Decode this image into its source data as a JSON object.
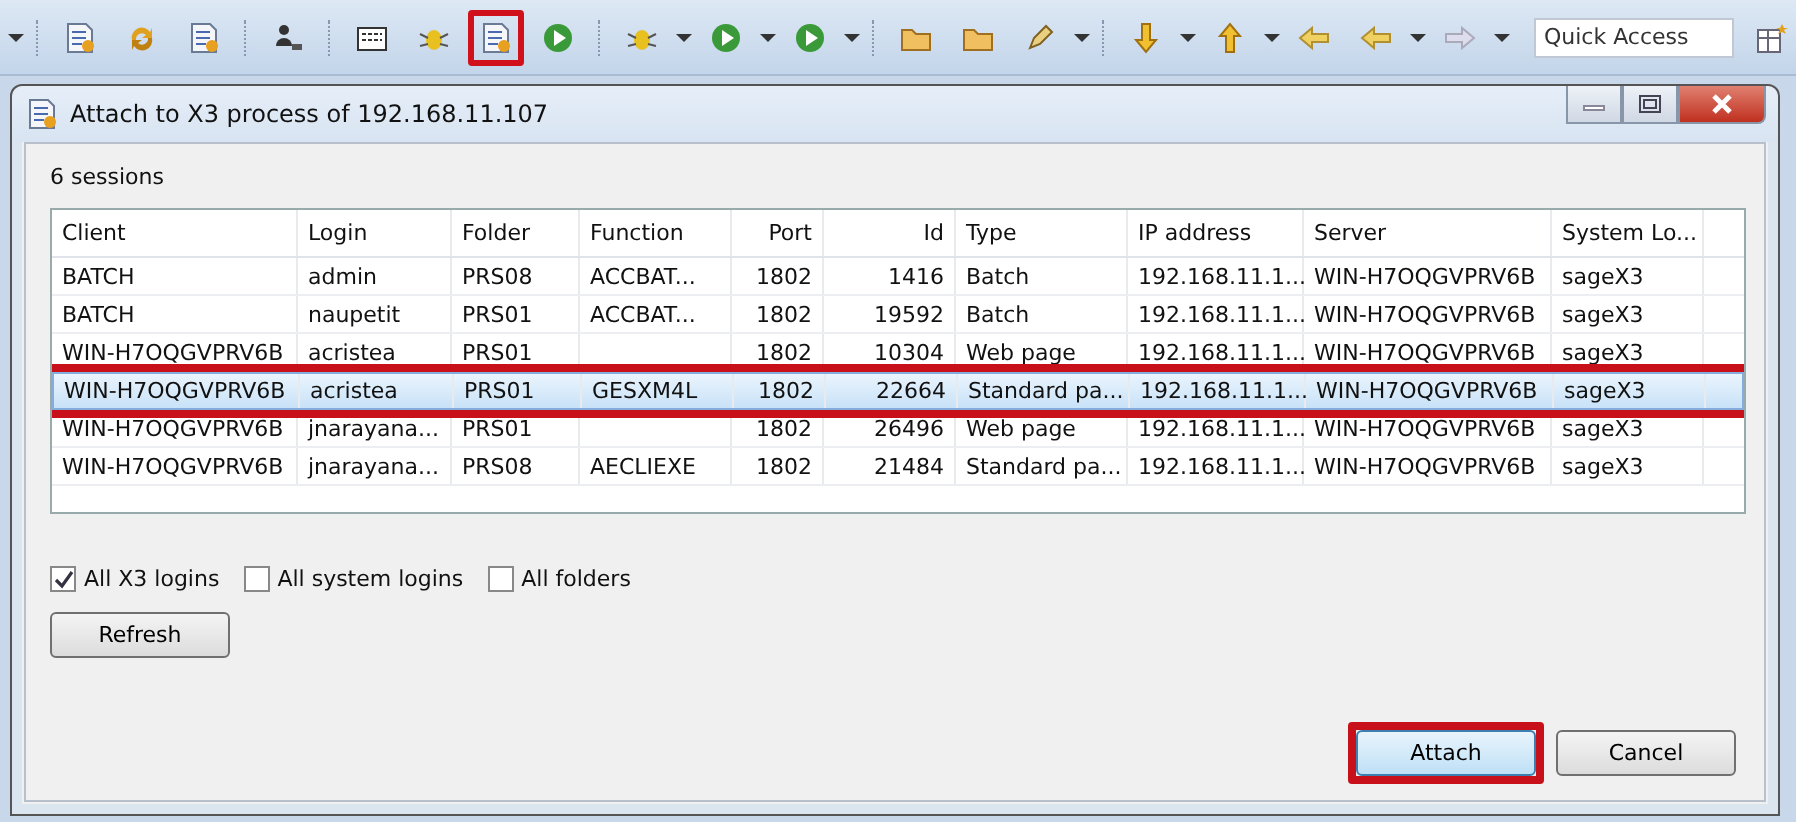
{
  "toolbar": {
    "items": [
      {
        "kind": "dropdown",
        "highlighted": false
      },
      {
        "kind": "separator",
        "highlighted": false
      },
      {
        "kind": "doc",
        "highlighted": false
      },
      {
        "kind": "cycle",
        "highlighted": false
      },
      {
        "kind": "doc",
        "highlighted": false
      },
      {
        "kind": "separator",
        "highlighted": false
      },
      {
        "kind": "person",
        "highlighted": false
      },
      {
        "kind": "separator",
        "highlighted": false
      },
      {
        "kind": "panel",
        "highlighted": false
      },
      {
        "kind": "bug",
        "highlighted": false
      },
      {
        "kind": "doc",
        "highlighted": true
      },
      {
        "kind": "play",
        "highlighted": false
      },
      {
        "kind": "separator",
        "highlighted": false
      },
      {
        "kind": "bug",
        "highlighted": false
      },
      {
        "kind": "dropdown",
        "highlighted": false
      },
      {
        "kind": "play",
        "highlighted": false
      },
      {
        "kind": "dropdown",
        "highlighted": false
      },
      {
        "kind": "play",
        "highlighted": false
      },
      {
        "kind": "dropdown",
        "highlighted": false
      },
      {
        "kind": "separator",
        "highlighted": false
      },
      {
        "kind": "folder",
        "highlighted": false
      },
      {
        "kind": "folder",
        "highlighted": false
      },
      {
        "kind": "pen",
        "highlighted": false
      },
      {
        "kind": "dropdown",
        "highlighted": false
      },
      {
        "kind": "separator",
        "highlighted": false
      },
      {
        "kind": "down",
        "highlighted": false
      },
      {
        "kind": "dropdown",
        "highlighted": false
      },
      {
        "kind": "up",
        "highlighted": false
      },
      {
        "kind": "dropdown",
        "highlighted": false
      },
      {
        "kind": "back",
        "highlighted": false
      },
      {
        "kind": "back",
        "highlighted": false
      },
      {
        "kind": "dropdown",
        "highlighted": false
      },
      {
        "kind": "forward",
        "highlighted": false
      },
      {
        "kind": "dropdown",
        "highlighted": false
      }
    ],
    "quick_access": {
      "placeholder": "Quick Access"
    }
  },
  "dialog": {
    "title": "Attach to X3 process of 192.168.11.107",
    "session_count": "6 sessions",
    "table": {
      "columns": [
        "Client",
        "Login",
        "Folder",
        "Function",
        "Port",
        "Id",
        "Type",
        "IP address",
        "Server",
        "System Lo..."
      ],
      "rows": [
        {
          "cells": [
            "BATCH",
            "admin",
            "PRS08",
            "ACCBAT...",
            "1802",
            "1416",
            "Batch",
            "192.168.11.1...",
            "WIN-H7OQGVPRV6B",
            "sageX3"
          ],
          "selected": false,
          "highlighted": false
        },
        {
          "cells": [
            "BATCH",
            "naupetit",
            "PRS01",
            "ACCBAT...",
            "1802",
            "19592",
            "Batch",
            "192.168.11.1...",
            "WIN-H7OQGVPRV6B",
            "sageX3"
          ],
          "selected": false,
          "highlighted": false
        },
        {
          "cells": [
            "WIN-H7OQGVPRV6B",
            "acristea",
            "PRS01",
            "",
            "1802",
            "10304",
            "Web page",
            "192.168.11.1...",
            "WIN-H7OQGVPRV6B",
            "sageX3"
          ],
          "selected": false,
          "highlighted": false
        },
        {
          "cells": [
            "WIN-H7OQGVPRV6B",
            "acristea",
            "PRS01",
            "GESXM4L",
            "1802",
            "22664",
            "Standard pa...",
            "192.168.11.1...",
            "WIN-H7OQGVPRV6B",
            "sageX3"
          ],
          "selected": true,
          "highlighted": true
        },
        {
          "cells": [
            "WIN-H7OQGVPRV6B",
            "jnarayana...",
            "PRS01",
            "",
            "1802",
            "26496",
            "Web page",
            "192.168.11.1...",
            "WIN-H7OQGVPRV6B",
            "sageX3"
          ],
          "selected": false,
          "highlighted": false
        },
        {
          "cells": [
            "WIN-H7OQGVPRV6B",
            "jnarayana...",
            "PRS08",
            "AECLIEXE",
            "1802",
            "21484",
            "Standard pa...",
            "192.168.11.1...",
            "WIN-H7OQGVPRV6B",
            "sageX3"
          ],
          "selected": false,
          "highlighted": false
        }
      ]
    },
    "filters": [
      {
        "label": "All X3 logins",
        "checked": true
      },
      {
        "label": "All system logins",
        "checked": false
      },
      {
        "label": "All folders",
        "checked": false
      }
    ],
    "refresh_button": "Refresh",
    "buttons": [
      {
        "label": "Attach",
        "highlighted": true
      },
      {
        "label": "Cancel",
        "highlighted": false
      }
    ]
  }
}
